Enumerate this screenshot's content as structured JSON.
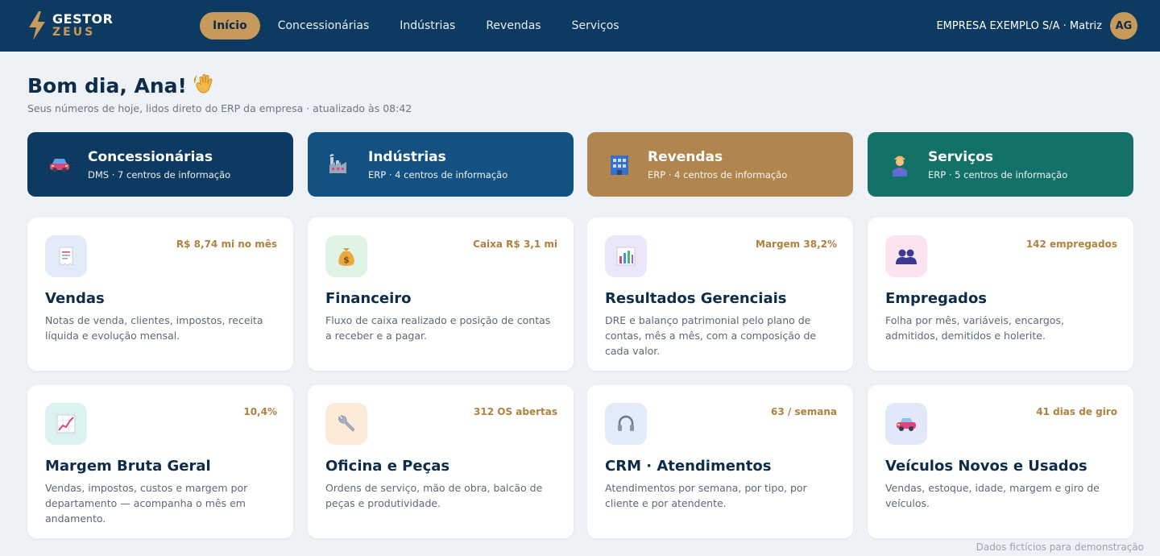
{
  "header": {
    "logo_line1": "GESTOR",
    "logo_line2": "ZEUS",
    "nav": [
      "Início",
      "Concessionárias",
      "Indústrias",
      "Revendas",
      "Serviços"
    ],
    "company": "EMPRESA EXEMPLO S/A · Matriz",
    "avatar_initials": "AG"
  },
  "greeting": {
    "title": "Bom dia, Ana!",
    "subtitle": "Seus números de hoje, lidos direto do ERP da empresa · atualizado às 08:42"
  },
  "categories": [
    {
      "title": "Concessionárias",
      "subtitle": "DMS · 7 centros de informação",
      "icon": "car-icon",
      "color": "#0d3a60"
    },
    {
      "title": "Indústrias",
      "subtitle": "ERP · 4 centros de informação",
      "icon": "factory-icon",
      "color": "#145183"
    },
    {
      "title": "Revendas",
      "subtitle": "ERP · 4 centros de informação",
      "icon": "store-icon",
      "color": "#b0854e"
    },
    {
      "title": "Serviços",
      "subtitle": "ERP · 5 centros de informação",
      "icon": "worker-icon",
      "color": "#147168"
    }
  ],
  "cards": [
    {
      "title": "Vendas",
      "metric": "R$ 8,74 mi no mês",
      "desc": "Notas de venda, clientes, impostos, receita líquida e evolução mensal.",
      "icon": "receipt-icon",
      "icon_bg": "#e3ebfb"
    },
    {
      "title": "Financeiro",
      "metric": "Caixa R$ 3,1 mi",
      "desc": "Fluxo de caixa realizado e posição de contas a receber e a pagar.",
      "icon": "money-bag-icon",
      "icon_bg": "#e0f4e6"
    },
    {
      "title": "Resultados Gerenciais",
      "metric": "Margem 38,2%",
      "desc": "DRE e balanço patrimonial pelo plano de contas, mês a mês, com a composição de cada valor.",
      "icon": "bar-chart-icon",
      "icon_bg": "#ece6fb"
    },
    {
      "title": "Empregados",
      "metric": "142 empregados",
      "desc": "Folha por mês, variáveis, encargos, admitidos, demitidos e holerite.",
      "icon": "people-icon",
      "icon_bg": "#fbe4ef"
    },
    {
      "title": "Margem Bruta Geral",
      "metric": "10,4%",
      "desc": "Vendas, impostos, custos e margem por departamento — acompanha o mês em andamento.",
      "icon": "trend-chart-icon",
      "icon_bg": "#dcf2f0"
    },
    {
      "title": "Oficina e Peças",
      "metric": "312 OS abertas",
      "desc": "Ordens de serviço, mão de obra, balcão de peças e produtividade.",
      "icon": "wrench-icon",
      "icon_bg": "#fcebd8"
    },
    {
      "title": "CRM · Atendimentos",
      "metric": "63 / semana",
      "desc": "Atendimentos por semana, por tipo, por cliente e por atendente.",
      "icon": "headset-icon",
      "icon_bg": "#e1ecf8"
    },
    {
      "title": "Veículos Novos e Usados",
      "metric": "41 dias de giro",
      "desc": "Vendas, estoque, idade, margem e giro de veículos.",
      "icon": "vehicle-icon",
      "icon_bg": "#e0e8fa"
    }
  ],
  "footer_note": "Dados fictícios para demonstração"
}
